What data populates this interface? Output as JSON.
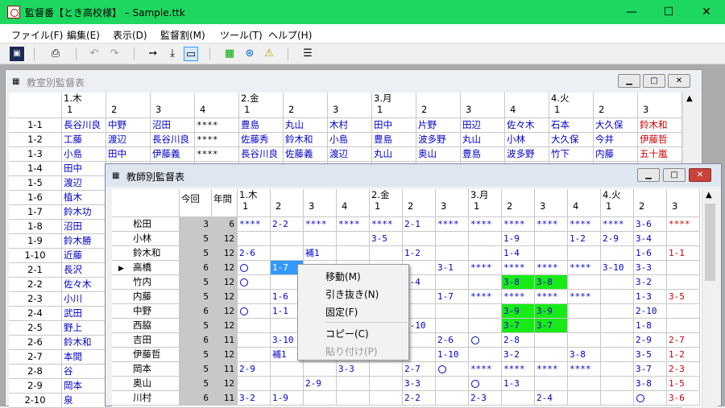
{
  "title_bar": {
    "title": "監督番【とき高校様】 – Sample.ttk",
    "minimize": "—",
    "maximize": "☐",
    "close": "✕"
  },
  "menu": [
    "ファイル(F)",
    "編集(E)",
    "表示(D)",
    "監督割(M)",
    "ツール(T)",
    "ヘルプ(H)"
  ],
  "toolbar_icons": [
    "save-icon",
    "print-icon",
    "undo-icon",
    "redo-icon",
    "move-right-icon",
    "move-down-icon",
    "frame-icon",
    "grid-green-icon",
    "globe-icon",
    "warning-person-icon",
    "list-icon"
  ],
  "room_window": {
    "title": "教室別監督表",
    "day_labels": [
      {
        "col": 1,
        "text": "1.木"
      },
      {
        "col": 5,
        "text": "2.金"
      },
      {
        "col": 8,
        "text": "3.月"
      },
      {
        "col": 12,
        "text": "4.火"
      }
    ],
    "periods": [
      "1",
      "2",
      "3",
      "4",
      "1",
      "2",
      "3",
      "1",
      "2",
      "3",
      "4",
      "1",
      "2",
      "3"
    ],
    "rows": [
      {
        "room": "1-1",
        "cells": [
          "長谷川良",
          "中野",
          "沼田",
          "****",
          "豊島",
          "丸山",
          "木村",
          "田中",
          "片野",
          "田辺",
          "佐々木",
          "石本",
          "大久保",
          "鈴木和"
        ]
      },
      {
        "room": "1-2",
        "cells": [
          "工藤",
          "渡辺",
          "長谷川良",
          "****",
          "佐藤秀",
          "鈴木和",
          "小島",
          "豊島",
          "波多野",
          "丸山",
          "小林",
          "大久保",
          "今井",
          "伊藤哲"
        ]
      },
      {
        "room": "1-3",
        "cells": [
          "小島",
          "田中",
          "伊藤義",
          "****",
          "長谷川良",
          "佐藤義",
          "渡辺",
          "丸山",
          "奥山",
          "豊島",
          "波多野",
          "竹下",
          "内藤",
          "五十嵐"
        ]
      },
      {
        "room": "1-4",
        "cells": [
          "田中"
        ]
      },
      {
        "room": "1-5",
        "cells": [
          "渡辺"
        ]
      },
      {
        "room": "1-6",
        "cells": [
          "植木"
        ]
      },
      {
        "room": "1-7",
        "cells": [
          "鈴木功"
        ]
      },
      {
        "room": "1-8",
        "cells": [
          "沼田"
        ]
      },
      {
        "room": "1-9",
        "cells": [
          "鈴木勝"
        ]
      },
      {
        "room": "1-10",
        "cells": [
          "近藤"
        ]
      },
      {
        "room": "2-1",
        "cells": [
          "長沢"
        ]
      },
      {
        "room": "2-2",
        "cells": [
          "佐々木"
        ]
      },
      {
        "room": "2-3",
        "cells": [
          "小川"
        ]
      },
      {
        "room": "2-4",
        "cells": [
          "武田"
        ]
      },
      {
        "room": "2-5",
        "cells": [
          "野上"
        ]
      },
      {
        "room": "2-6",
        "cells": [
          "鈴木和"
        ]
      },
      {
        "room": "2-7",
        "cells": [
          "本間"
        ]
      },
      {
        "room": "2-8",
        "cells": [
          "谷"
        ]
      },
      {
        "room": "2-9",
        "cells": [
          "岡本"
        ]
      },
      {
        "room": "2-10",
        "cells": [
          "泉"
        ]
      }
    ]
  },
  "teacher_window": {
    "title": "教師別監督表",
    "col_count": "今回",
    "col_year": "年間",
    "day_labels": [
      {
        "col": 0,
        "text": "1.木"
      },
      {
        "col": 4,
        "text": "2.金"
      },
      {
        "col": 7,
        "text": "3.月"
      },
      {
        "col": 11,
        "text": "4.火"
      }
    ],
    "periods": [
      "1",
      "2",
      "3",
      "4",
      "1",
      "2",
      "3",
      "1",
      "2",
      "3",
      "4",
      "1",
      "2",
      "3"
    ],
    "rows": [
      {
        "name": "松田",
        "count": "3",
        "year": "6",
        "cells": [
          "****",
          "2-2",
          "****",
          "****",
          "****",
          "2-1",
          "****",
          "****",
          "****",
          "****",
          "****",
          "****",
          "3-6",
          "****"
        ]
      },
      {
        "name": "小林",
        "count": "5",
        "year": "12",
        "cells": [
          "",
          "",
          "",
          "",
          "3-5",
          "",
          "",
          "",
          "1-9",
          "",
          "1-2",
          "2-9",
          "3-4",
          ""
        ]
      },
      {
        "name": "鈴木和",
        "count": "5",
        "year": "12",
        "cells": [
          "2-6",
          "",
          "補1",
          "",
          "",
          "1-2",
          "",
          "",
          "1-4",
          "",
          "",
          "",
          "1-6",
          "1-1"
        ]
      },
      {
        "name": "高橋",
        "count": "6",
        "year": "12",
        "current": true,
        "cells": [
          "○",
          "1-7",
          "",
          "2-5",
          "2-8",
          "",
          "3-1",
          "****",
          "****",
          "****",
          "****",
          "3-10",
          "3-3",
          ""
        ]
      },
      {
        "name": "竹内",
        "count": "5",
        "year": "12",
        "cells": [
          "○",
          "",
          "",
          "",
          "",
          "2-4",
          "",
          "",
          "3-8",
          "3-8",
          "",
          "",
          "3-2",
          ""
        ]
      },
      {
        "name": "内藤",
        "count": "5",
        "year": "12",
        "cells": [
          "",
          "1-6",
          "",
          "",
          "",
          "",
          "1-7",
          "****",
          "****",
          "****",
          "****",
          "",
          "1-3",
          "3-5"
        ]
      },
      {
        "name": "中野",
        "count": "6",
        "year": "12",
        "cells": [
          "○",
          "1-1",
          "",
          "",
          "",
          "",
          "",
          "",
          "3-9",
          "3-9",
          "",
          "",
          "2-10",
          ""
        ]
      },
      {
        "name": "西脇",
        "count": "5",
        "year": "12",
        "cells": [
          "",
          "",
          "",
          "",
          "",
          "2-10",
          "",
          "",
          "3-7",
          "3-7",
          "",
          "",
          "1-8",
          ""
        ]
      },
      {
        "name": "吉田",
        "count": "6",
        "year": "11",
        "cells": [
          "",
          "3-10",
          "",
          "",
          "",
          "",
          "2-6",
          "○",
          "2-8",
          "",
          "",
          "",
          "2-9",
          "2-7"
        ]
      },
      {
        "name": "伊藤哲",
        "count": "5",
        "year": "12",
        "cells": [
          "",
          "補1",
          "",
          "",
          "",
          "",
          "1-10",
          "",
          "3-2",
          "",
          "3-8",
          "",
          "3-5",
          "1-2"
        ]
      },
      {
        "name": "岡本",
        "count": "5",
        "year": "11",
        "cells": [
          "2-9",
          "",
          "",
          "3-3",
          "",
          "2-7",
          "○",
          "****",
          "****",
          "****",
          "****",
          "",
          "3-7",
          "2-3"
        ]
      },
      {
        "name": "奥山",
        "count": "5",
        "year": "12",
        "cells": [
          "",
          "",
          "2-9",
          "",
          "",
          "3-3",
          "",
          "○",
          "1-3",
          "",
          "",
          "",
          "3-8",
          "1-5"
        ]
      },
      {
        "name": "川村",
        "count": "6",
        "year": "11",
        "cells": [
          "3-2",
          "1-9",
          "",
          "",
          "",
          "2-2",
          "",
          "2-3",
          "",
          "2-4",
          "",
          "",
          "○",
          "3-6"
        ]
      }
    ]
  },
  "context_menu": {
    "move": "移動(M)",
    "extract": "引き抜き(N)",
    "fix": "固定(F)",
    "copy": "コピー(C)",
    "paste": "貼り付け(P)"
  },
  "colors": {
    "titlebar": "#1ed760",
    "blue_text": "#0000cc",
    "red_text": "#cc0000",
    "selection": "#3399ff",
    "green_cell": "#18ea18"
  }
}
